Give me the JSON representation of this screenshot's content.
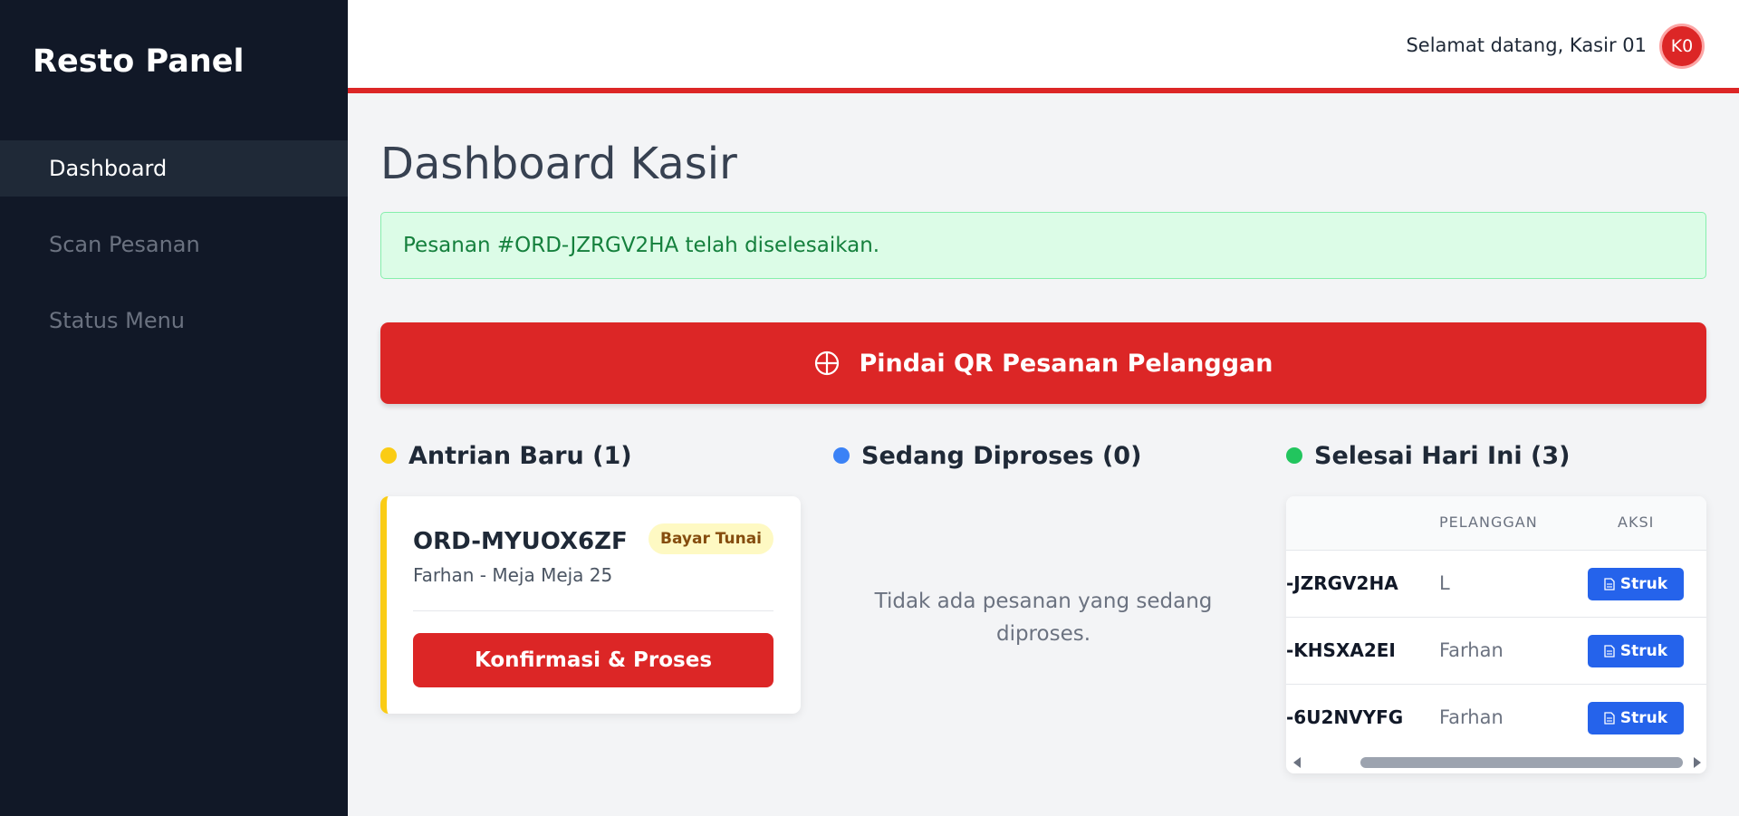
{
  "app": {
    "brand": "Resto Panel"
  },
  "sidebar": {
    "items": [
      {
        "label": "Dashboard",
        "active": true
      },
      {
        "label": "Scan Pesanan",
        "active": false
      },
      {
        "label": "Status Menu",
        "active": false
      }
    ]
  },
  "header": {
    "greeting": "Selamat datang, Kasir 01",
    "avatar_initials": "K0"
  },
  "page": {
    "title": "Dashboard Kasir"
  },
  "alert": {
    "message": "Pesanan #ORD-JZRGV2HA telah diselesaikan."
  },
  "scan_button": {
    "label": "Pindai QR Pesanan Pelanggan",
    "icon": "crosshair-icon"
  },
  "columns": {
    "new": {
      "title": "Antrian Baru (1)",
      "dot_color": "#facc15",
      "order": {
        "id": "ORD-MYUOX6ZF",
        "payment_badge": "Bayar Tunai",
        "subtitle": "Farhan - Meja Meja 25",
        "action_label": "Konfirmasi & Proses"
      }
    },
    "processing": {
      "title": "Sedang Diproses (0)",
      "dot_color": "#3b82f6",
      "empty_text": "Tidak ada pesanan yang sedang diproses."
    },
    "done": {
      "title": "Selesai Hari Ini (3)",
      "dot_color": "#22c55e",
      "table": {
        "headers": {
          "customer": "PELANGGAN",
          "action": "AKSI"
        },
        "rows": [
          {
            "id": "-JZRGV2HA",
            "customer": "L",
            "action": "Struk"
          },
          {
            "id": "-KHSXA2EI",
            "customer": "Farhan",
            "action": "Struk"
          },
          {
            "id": "-6U2NVYFG",
            "customer": "Farhan",
            "action": "Struk"
          }
        ]
      }
    }
  },
  "colors": {
    "primary_red": "#dc2626",
    "sidebar_bg": "#111827",
    "blue_button": "#2563eb",
    "success_bg": "#dcfce7",
    "success_text": "#15803d"
  }
}
